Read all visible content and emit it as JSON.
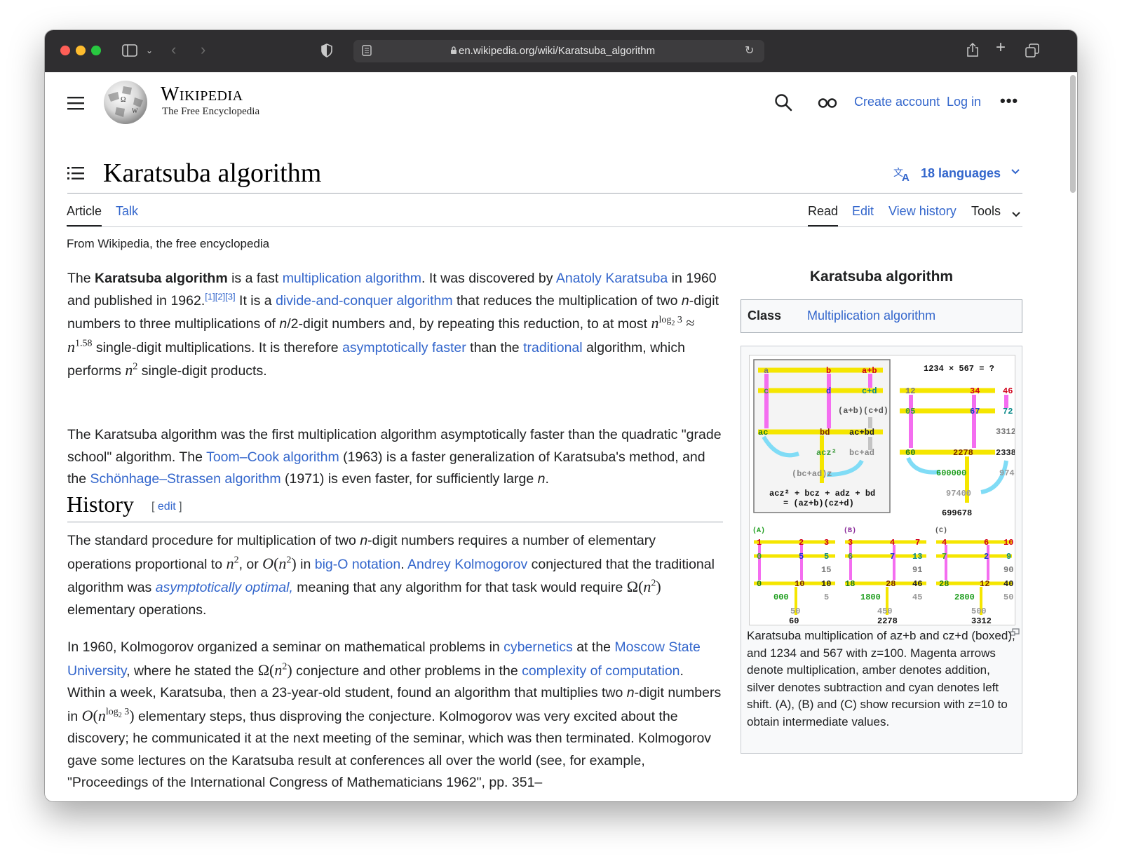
{
  "browser": {
    "url": "en.wikipedia.org/wiki/Karatsuba_algorithm"
  },
  "header": {
    "wordmark": "Wikipedia",
    "tagline": "The Free Encyclopedia",
    "create_account": "Create account",
    "log_in": "Log in"
  },
  "page": {
    "title": "Karatsuba algorithm",
    "languages": "18 languages",
    "tabs": {
      "article": "Article",
      "talk": "Talk",
      "read": "Read",
      "edit": "Edit",
      "view_history": "View history",
      "tools": "Tools"
    },
    "from": "From Wikipedia, the free encyclopedia"
  },
  "infobox": {
    "title": "Karatsuba algorithm",
    "class_label": "Class",
    "class_value": "Multiplication algorithm",
    "caption": "Karatsuba multiplication of az+b and cz+d (boxed), and 1234 and 567 with z=100. Magenta arrows denote multiplication, amber denotes addition, silver denotes subtraction and cyan denotes left shift. (A), (B) and (C) show recursion with z=10 to obtain intermediate values.",
    "diagram": {
      "header": "1234 × 567 = ?",
      "formula1": "acz² + bcz + adz + bd",
      "formula2": "= (az+b)(cz+d)",
      "totals": [
        "699678",
        "60",
        "2278",
        "3312"
      ]
    }
  },
  "intro": {
    "p1": {
      "t1": "The ",
      "bold": "Karatsuba algorithm",
      "t2": " is a fast ",
      "l1": "multiplication algorithm",
      "t3": ". It was discovered by ",
      "l2": "Anatoly Karatsuba",
      "t4": " in 1960 and published in 1962.",
      "refs": "[1][2][3]",
      "t5": " It is a ",
      "l3": "divide-and-conquer algorithm",
      "t6": " that reduces the multiplication of two ",
      "n1": "n",
      "t7": "-digit numbers to three multiplications of ",
      "n2": "n",
      "t8": "/2-digit numbers and, by repeating this reduction, to at most ",
      "t9": " single-digit multiplications. It is therefore ",
      "l4": "asymptotically faster",
      "t10": " than the ",
      "l5": "traditional",
      "t11": " algorithm, which performs ",
      "t12": " single-digit products."
    },
    "p2": {
      "t1": "The Karatsuba algorithm was the first multiplication algorithm asymptotically faster than the quadratic \"grade school\" algorithm. The ",
      "l1": "Toom–Cook algorithm",
      "t2": " (1963) is a faster generalization of Karatsuba's method, and the ",
      "l2": "Schönhage–Strassen algorithm",
      "t3": " (1971) is even faster, for sufficiently large ",
      "n": "n",
      "t4": "."
    }
  },
  "history": {
    "heading": "History",
    "edit": "edit",
    "p1": {
      "t1": "The standard procedure for multiplication of two ",
      "n": "n",
      "t2": "-digit numbers requires a number of elementary operations proportional to ",
      "t3": ", or ",
      "t4": " in ",
      "l1": "big-O notation",
      "t5": ". ",
      "l2": "Andrey Kolmogorov",
      "t6": " conjectured that the traditional algorithm was ",
      "l3": "asymptotically optimal,",
      "t7": " meaning that any algorithm for that task would require ",
      "t8": " elementary operations."
    },
    "p2": {
      "t1": "In 1960, Kolmogorov organized a seminar on mathematical problems in ",
      "l1": "cybernetics",
      "t2": " at the ",
      "l2": "Moscow State University",
      "t3": ", where he stated the ",
      "t4": " conjecture and other problems in the ",
      "l3": "complexity of computation",
      "t5": ". Within a week, Karatsuba, then a 23-year-old student, found an algorithm that multiplies two ",
      "n": "n",
      "t6": "-digit numbers in ",
      "t7": " elementary steps, thus disproving the conjecture. Kolmogorov was very excited about the discovery; he communicated it at the next meeting of the seminar, which was then terminated. Kolmogorov gave some lectures on the Karatsuba result at conferences all over the world (see, for example, \"Proceedings of the International Congress of Mathematicians 1962\", pp. 351–"
    }
  }
}
